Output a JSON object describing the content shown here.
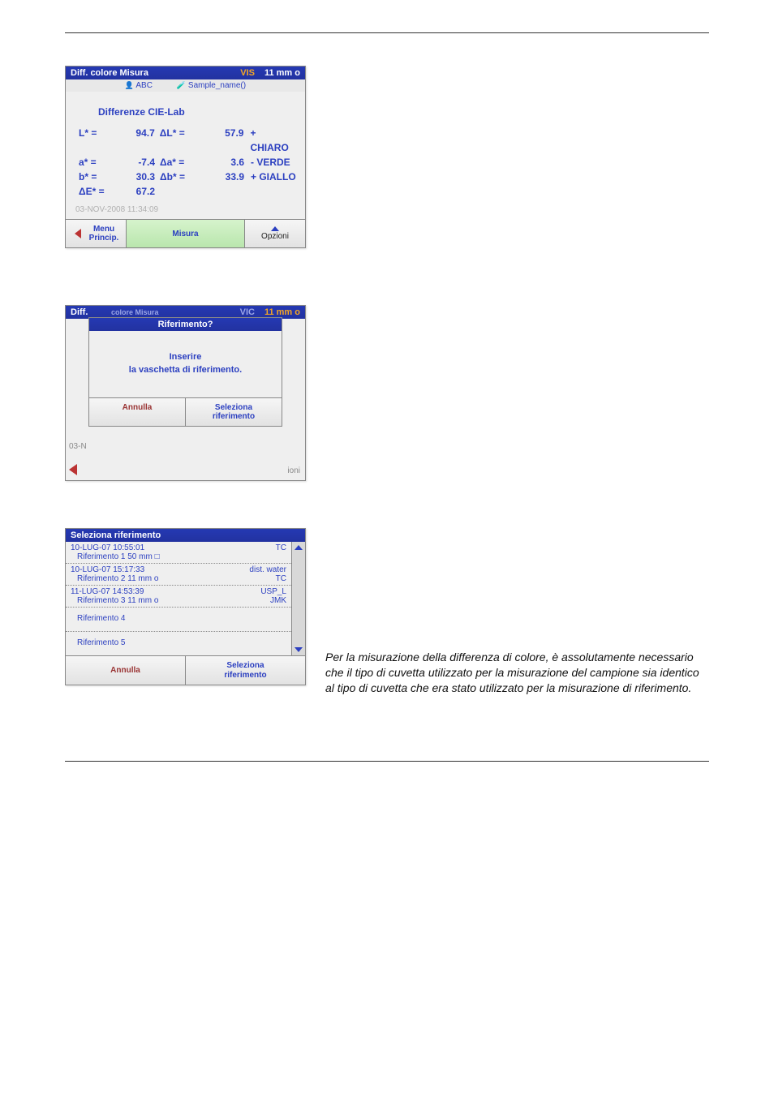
{
  "panel1": {
    "title_left": "Diff. colore Misura",
    "title_mode": "VIS",
    "title_right": "11 mm o",
    "sub_abc": "ABC",
    "sub_sample": "Sample_name()",
    "section": "Differenze CIE-Lab",
    "r1": {
      "lab": "L* =",
      "val": "94.7",
      "dlab": "ΔL* =",
      "dval": "57.9",
      "word": "+ CHIARO"
    },
    "r2": {
      "lab": "a* =",
      "val": "-7.4",
      "dlab": "Δa* =",
      "dval": "3.6",
      "word": "- VERDE"
    },
    "r3": {
      "lab": "b* =",
      "val": "30.3",
      "dlab": "Δb* =",
      "dval": "33.9",
      "word": "+ GIALLO"
    },
    "r4": {
      "lab": "ΔE* =",
      "val": "67.2"
    },
    "timestamp": "03-NOV-2008  11:34:09",
    "btn_menu_l1": "Menu",
    "btn_menu_l2": "Princip.",
    "btn_misura": "Misura",
    "btn_opzioni": "Opzioni"
  },
  "panel2": {
    "bg_title_left": "Diff.",
    "bg_title_mid": "colore Misura",
    "bg_title_mode": "VIC",
    "bg_title_right": "11 mm o",
    "side_label": "03-N",
    "right_label": "ioni",
    "modal_title": "Riferimento?",
    "modal_line1": "Inserire",
    "modal_line2": "la vaschetta di riferimento.",
    "btn_annulla": "Annulla",
    "btn_seleziona_l1": "Seleziona",
    "btn_seleziona_l2": "riferimento"
  },
  "panel3": {
    "title": "Seleziona riferimento",
    "rows": [
      {
        "l1": "10-LUG-07  10:55:01",
        "l2": "Riferimento 1   50 mm □",
        "r1": "",
        "r2": "TC"
      },
      {
        "l1": "10-LUG-07  15:17:33",
        "l2": "Riferimento 2   11 mm o",
        "r1": "dist. water",
        "r2": "TC"
      },
      {
        "l1": "11-LUG-07  14:53:39",
        "l2": "Riferimento 3   11 mm o",
        "r1": "USP_L",
        "r2": "JMK"
      }
    ],
    "empty4": "Riferimento 4",
    "empty5": "Riferimento 5",
    "btn_annulla": "Annulla",
    "btn_seleziona_l1": "Seleziona",
    "btn_seleziona_l2": "riferimento"
  },
  "note": "Per la misurazione della differenza di colore, è assolutamente necessario che il tipo di cuvetta utilizzato per la misurazione del campione sia identico al tipo di cuvetta che era stato utilizzato per la misurazione di riferimento."
}
